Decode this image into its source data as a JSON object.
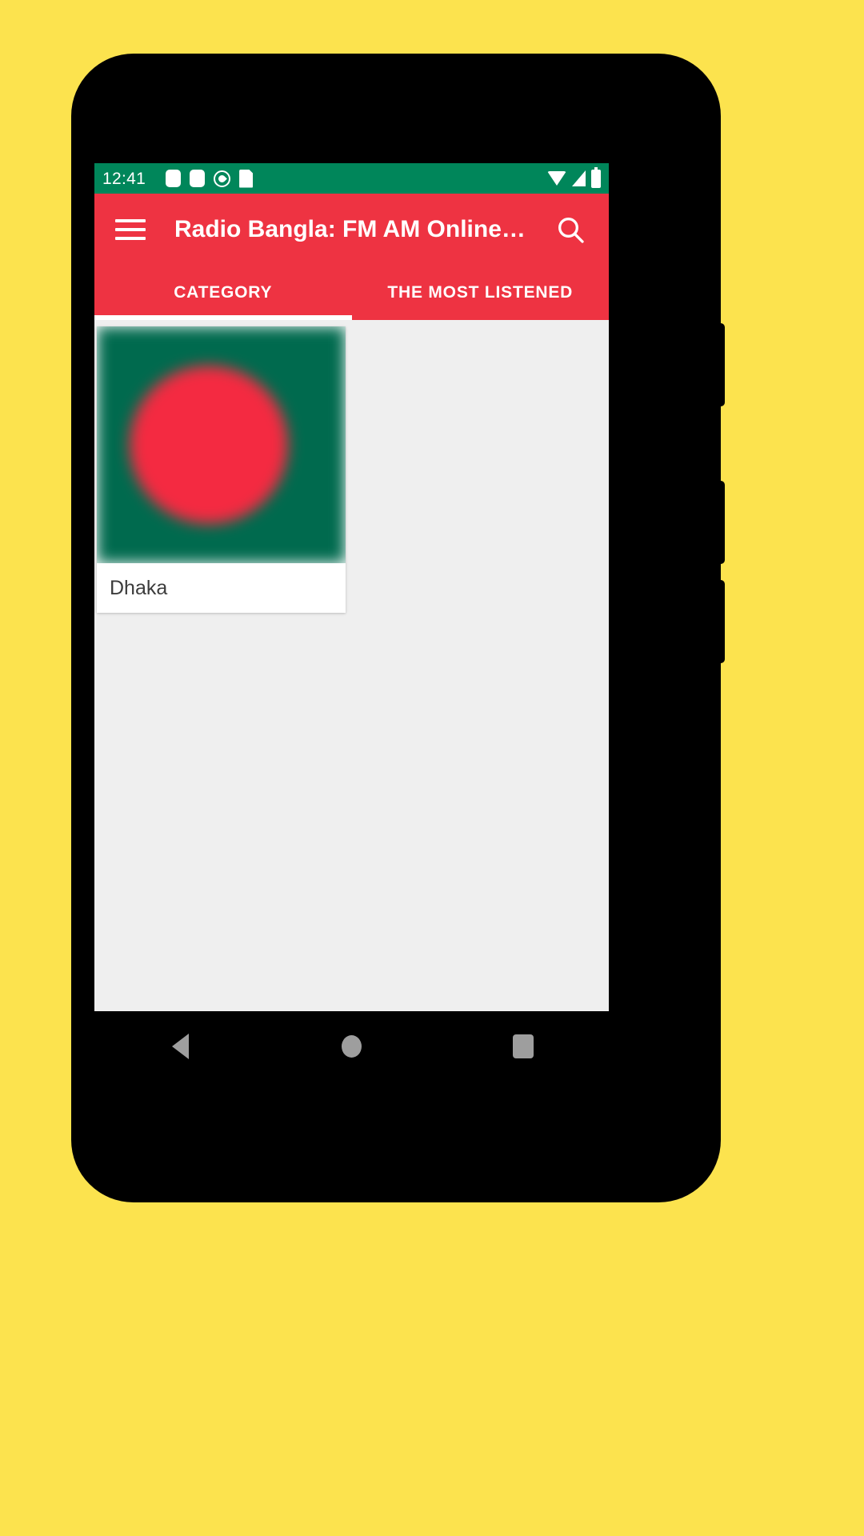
{
  "theme": {
    "page_background": "#FCE34E",
    "status_bar_color": "#00865A",
    "app_bar_color": "#EE3342",
    "content_background": "#EFEFEF",
    "card_background": "#FFFFFF",
    "flag_green": "#006A4E",
    "flag_red": "#F42A41",
    "nav_icon_color": "#9E9E9E"
  },
  "status_bar": {
    "clock": "12:41",
    "left_icons": [
      "rounded-square-icon",
      "rounded-square-icon",
      "adblock-circle-icon",
      "sdcard-icon"
    ],
    "right_icons": [
      "wifi-icon",
      "signal-icon",
      "battery-icon"
    ]
  },
  "app_bar": {
    "menu_icon": "hamburger-menu-icon",
    "title": "Radio Bangla: FM AM Online…",
    "search_icon": "search-icon"
  },
  "tabs": [
    {
      "label": "CATEGORY",
      "active": true
    },
    {
      "label": "THE MOST LISTENED",
      "active": false
    }
  ],
  "stations": [
    {
      "label": "Dhaka",
      "thumbnail": "bangladesh-flag"
    }
  ],
  "nav_bar": {
    "back_icon": "back-triangle-icon",
    "home_icon": "home-circle-icon",
    "recents_icon": "recents-square-icon"
  }
}
